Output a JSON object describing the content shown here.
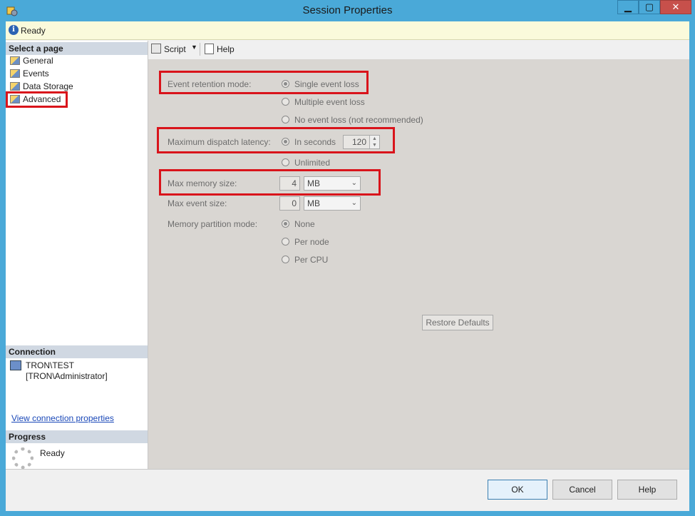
{
  "window": {
    "title": "Session Properties",
    "controls": {
      "minimize": "▁",
      "maximize": "▢",
      "close": "✕"
    }
  },
  "status": {
    "text": "Ready",
    "icon": "info-icon"
  },
  "left_pane": {
    "select_page_header": "Select a page",
    "pages": [
      {
        "label": "General"
      },
      {
        "label": "Events"
      },
      {
        "label": "Data Storage"
      },
      {
        "label": "Advanced"
      }
    ],
    "connection_header": "Connection",
    "connection_server": "TRON\\TEST",
    "connection_user": "[TRON\\Administrator]",
    "view_connection_link": "View connection properties",
    "progress_header": "Progress",
    "progress_status": "Ready"
  },
  "toolbar": {
    "script_label": "Script",
    "help_label": "Help"
  },
  "form": {
    "event_retention_label": "Event retention mode:",
    "retention_options": [
      "Single event loss",
      "Multiple event loss",
      "No event loss (not recommended)"
    ],
    "retention_selected": "Single event loss",
    "dispatch_latency_label": "Maximum dispatch latency:",
    "latency_options": [
      "In seconds",
      "Unlimited"
    ],
    "latency_value": "120",
    "max_memory_label": "Max memory size:",
    "max_memory_value": "4",
    "max_memory_unit": "MB",
    "max_event_label": "Max event size:",
    "max_event_value": "0",
    "max_event_unit": "MB",
    "partition_label": "Memory partition mode:",
    "partition_options": [
      "None",
      "Per node",
      "Per CPU"
    ],
    "partition_selected": "None",
    "restore_button": "Restore Defaults"
  },
  "buttons": {
    "ok": "OK",
    "cancel": "Cancel",
    "help": "Help"
  },
  "colors": {
    "highlight": "#d9141b",
    "title_bar": "#4aa9d8",
    "status_bar": "#fafadb"
  }
}
